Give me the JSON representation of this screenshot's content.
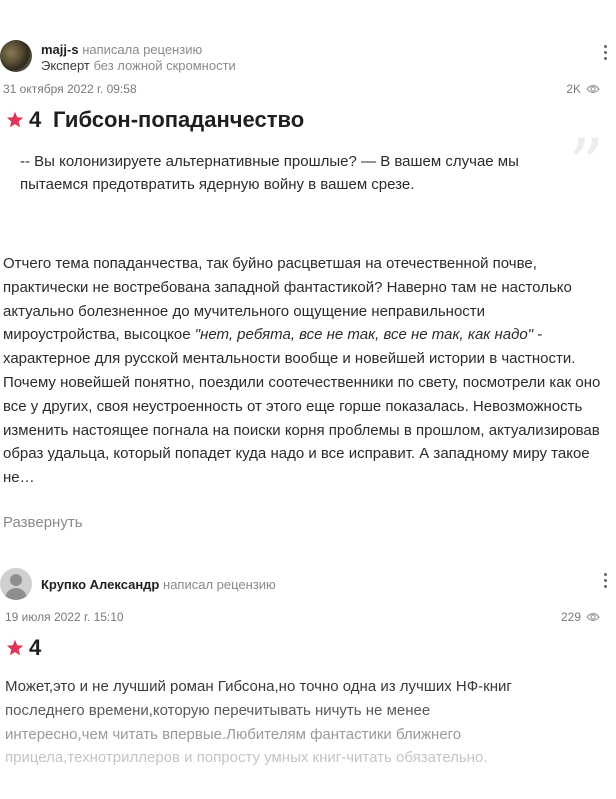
{
  "reviews": [
    {
      "author": "majj-s",
      "action": "написала рецензию",
      "rank": "Эксперт",
      "rank_desc": "без ложной скромности",
      "date": "31 октября 2022 г. 09:58",
      "views": "2K",
      "rating": "4",
      "title": "Гибсон-попаданчество",
      "quote": "-- Вы колонизируете альтернативные прошлые? — В вашем случае мы пытаемся предотвратить ядерную войну в вашем срезе.",
      "body_p1_a": "Отчего тема попаданчества, так буйно расцветшая на отечественной почве, практически не востребована западной фантастикой? Наверно там не настолько актуально болезненное до мучительного ощущение неправильности мироустройства, высоцкое ",
      "body_p1_em": "\"нет, ребята, все не так, все не так, как надо\"",
      "body_p1_b": " - характерное для русской ментальности вообще и новейшей истории в частности.",
      "body_p2": "Почему новейшей понятно, поездили соотечественники по свету, посмотрели как оно все у других, своя неустроенность от этого еще горше показалась. Невозможность изменить настоящее погнала на поиски корня проблемы в прошлом, актуализировав образ удальца, который попадет куда надо и все исправит. А западному миру такое не…",
      "expand": "Развернуть"
    },
    {
      "author": "Крупко Александр",
      "action": "написал рецензию",
      "date": "19 июля 2022 г. 15:10",
      "views": "229",
      "rating": "4",
      "line1": "Может,это и не лучший роман Гибсона,но точно одна из лучших НФ-книг",
      "line2": "последнего времени,которую перечитывать ничуть не менее",
      "line3": "интересно,чем читать впервые.Любителям фантастики ближнего",
      "line4": "прицела,технотриллеров и попросту умных книг-читать обязательно."
    }
  ],
  "colors": {
    "star": "#e0345a",
    "muted": "#8a8a8a",
    "text": "#2b2b2b"
  },
  "icons": {
    "star": "star-icon",
    "eye": "eye-icon",
    "menu": "more-vertical-icon",
    "quote": "quote-mark-icon"
  }
}
